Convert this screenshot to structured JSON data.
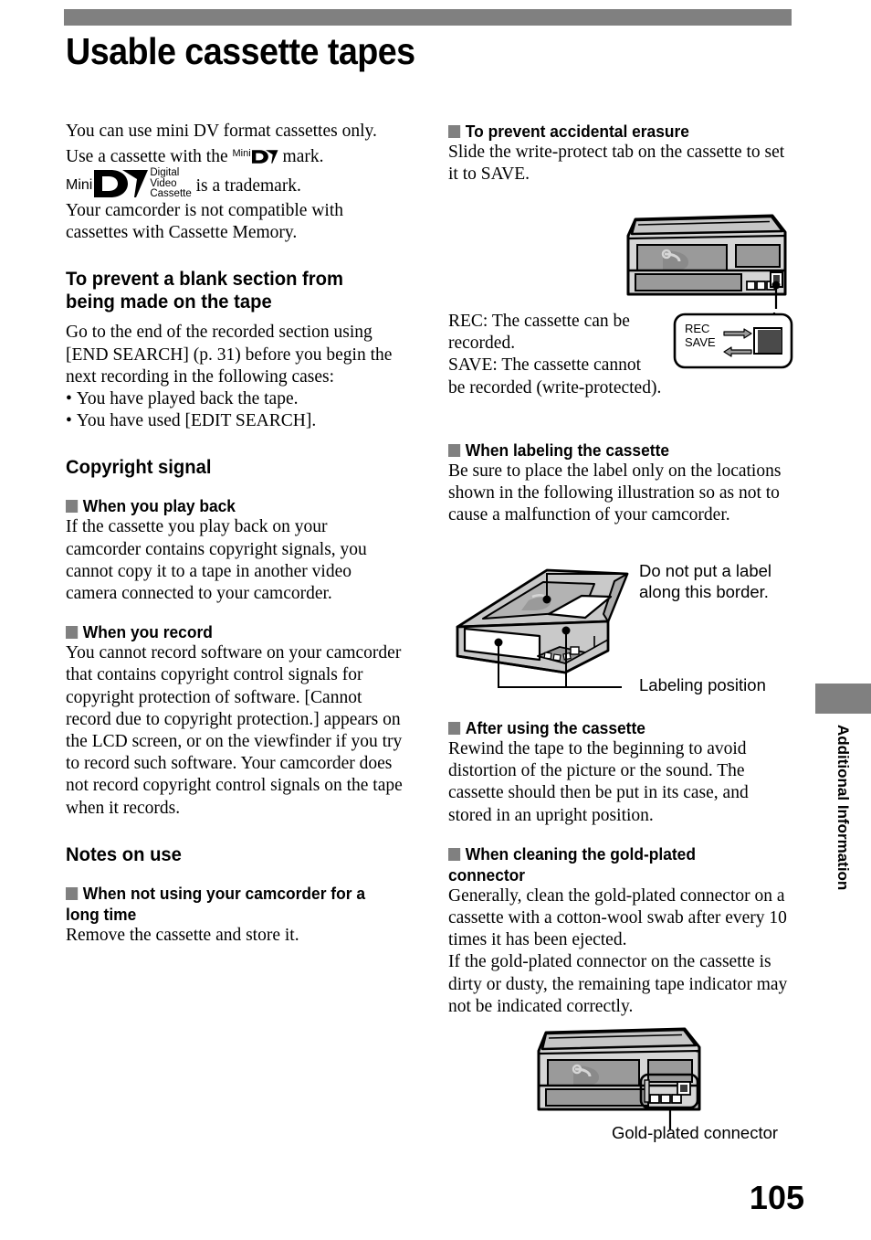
{
  "page": {
    "title": "Usable cassette tapes",
    "number": "105",
    "side_tab": "Additional Information",
    "accent_gray": "#808080"
  },
  "left_column": {
    "intro": {
      "line1": "You can use mini DV format cassettes only.",
      "line2_before": "Use a cassette with the",
      "line2_mark_mini": "Mini",
      "line2_mark_dv": "DV",
      "line2_after": "mark.",
      "logo_mini": "Mini",
      "logo_dv": "DV",
      "logo_dvc_1": "Digital",
      "logo_dvc_2": "Video",
      "logo_dvc_3": "Cassette",
      "logo_after": "is a trademark.",
      "line4": "Your camcorder is not compatible with cassettes with Cassette Memory."
    },
    "section_blank": {
      "heading": "To prevent a blank section from being made on the tape",
      "body": "Go to the end of the recorded section using [END SEARCH] (p. 31) before you begin the next recording in the following cases:",
      "bullets": [
        "You have played back the tape.",
        "You have used [EDIT SEARCH]."
      ]
    },
    "section_copyright": {
      "heading": "Copyright signal",
      "sub_playback": {
        "heading": "When you play back",
        "body": "If the cassette you play back on your camcorder contains copyright signals, you cannot copy it to a tape in another video camera connected to your camcorder."
      },
      "sub_record": {
        "heading": "When you record",
        "body": "You cannot record software on your camcorder that contains copyright control signals for copyright protection of software. [Cannot record due to copyright protection.] appears on the LCD screen, or on the viewfinder if you try to record such software. Your camcorder does not record copyright control signals on the tape when it records."
      }
    },
    "section_notes": {
      "heading": "Notes on use",
      "sub_longtime": {
        "heading": "When not using your camcorder for a long time",
        "body": "Remove the cassette and store it."
      }
    }
  },
  "right_column": {
    "section_erasure": {
      "heading": "To prevent accidental erasure",
      "body": "Slide the write-protect tab on the cassette to set it to SAVE."
    },
    "rec_save": {
      "description_line1": "REC: The cassette can be",
      "description_line2": "recorded.",
      "description_line3": "SAVE: The cassette cannot",
      "description_line4": "be recorded (write-protected).",
      "callout_rec": "REC",
      "callout_save": "SAVE"
    },
    "section_labeling": {
      "heading": "When labeling the cassette",
      "body": "Be sure to place the label only on the locations shown in the following illustration so as not to cause a malfunction of your camcorder.",
      "callout_border_line1": "Do not put a label",
      "callout_border_line2": "along this border.",
      "callout_position": "Labeling position"
    },
    "section_after_use": {
      "heading": "After using the cassette",
      "body": "Rewind the tape to the beginning to avoid distortion of the picture or the sound. The cassette should then be put in its case, and stored in an upright position."
    },
    "section_cleaning": {
      "heading": "When cleaning the gold-plated connector",
      "body_p1": "Generally, clean the gold-plated connector on a cassette with a cotton-wool swab after every 10 times it has been ejected.",
      "body_p2": "If the gold-plated connector on the cassette is dirty or dusty, the remaining tape indicator may not be indicated correctly.",
      "callout_connector": "Gold-plated connector"
    }
  },
  "icons": {
    "section_square": "gray-square-bullet",
    "cassette_front": "cassette-front-illustration",
    "cassette_iso": "cassette-isometric-illustration",
    "cassette_connector": "cassette-connector-illustration",
    "rec_save_switch": "rec-save-switch-illustration"
  }
}
